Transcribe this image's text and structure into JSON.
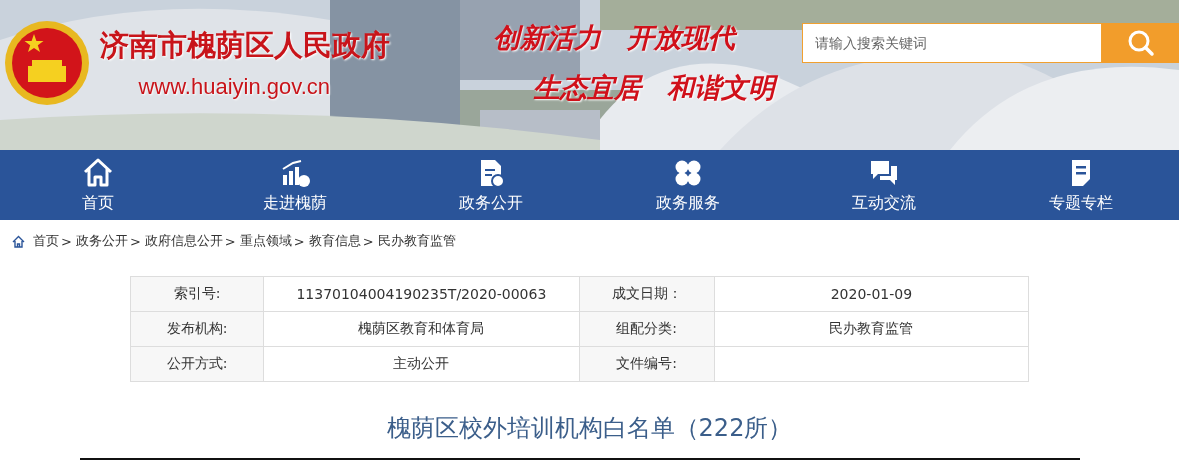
{
  "header": {
    "site_name": "济南市槐荫区人民政府",
    "url": "www.huaiyin.gov.cn",
    "slogans": [
      [
        "创新活力",
        "开放现代"
      ],
      [
        "生态宜居",
        "和谐文明"
      ]
    ],
    "search": {
      "placeholder": "请输入搜索关键词"
    }
  },
  "nav": [
    {
      "label": "首页"
    },
    {
      "label": "走进槐荫"
    },
    {
      "label": "政务公开"
    },
    {
      "label": "政务服务"
    },
    {
      "label": "互动交流"
    },
    {
      "label": "专题专栏"
    }
  ],
  "breadcrumb": {
    "separator": ">",
    "items": [
      "首页",
      "政务公开",
      "政府信息公开",
      "重点领域",
      "教育信息",
      "民办教育监管"
    ]
  },
  "info_table": [
    [
      {
        "label": "索引号:",
        "value": "11370104004190235T/2020-00063"
      },
      {
        "label": "成文日期：",
        "value": "2020-01-09"
      }
    ],
    [
      {
        "label": "发布机构:",
        "value": "槐荫区教育和体育局"
      },
      {
        "label": "组配分类:",
        "value": "民办教育监管"
      }
    ],
    [
      {
        "label": "公开方式:",
        "value": "主动公开"
      },
      {
        "label": "文件编号:"
      }
    ]
  ],
  "article": {
    "title": "槐荫区校外培训机构白名单（222所）"
  }
}
